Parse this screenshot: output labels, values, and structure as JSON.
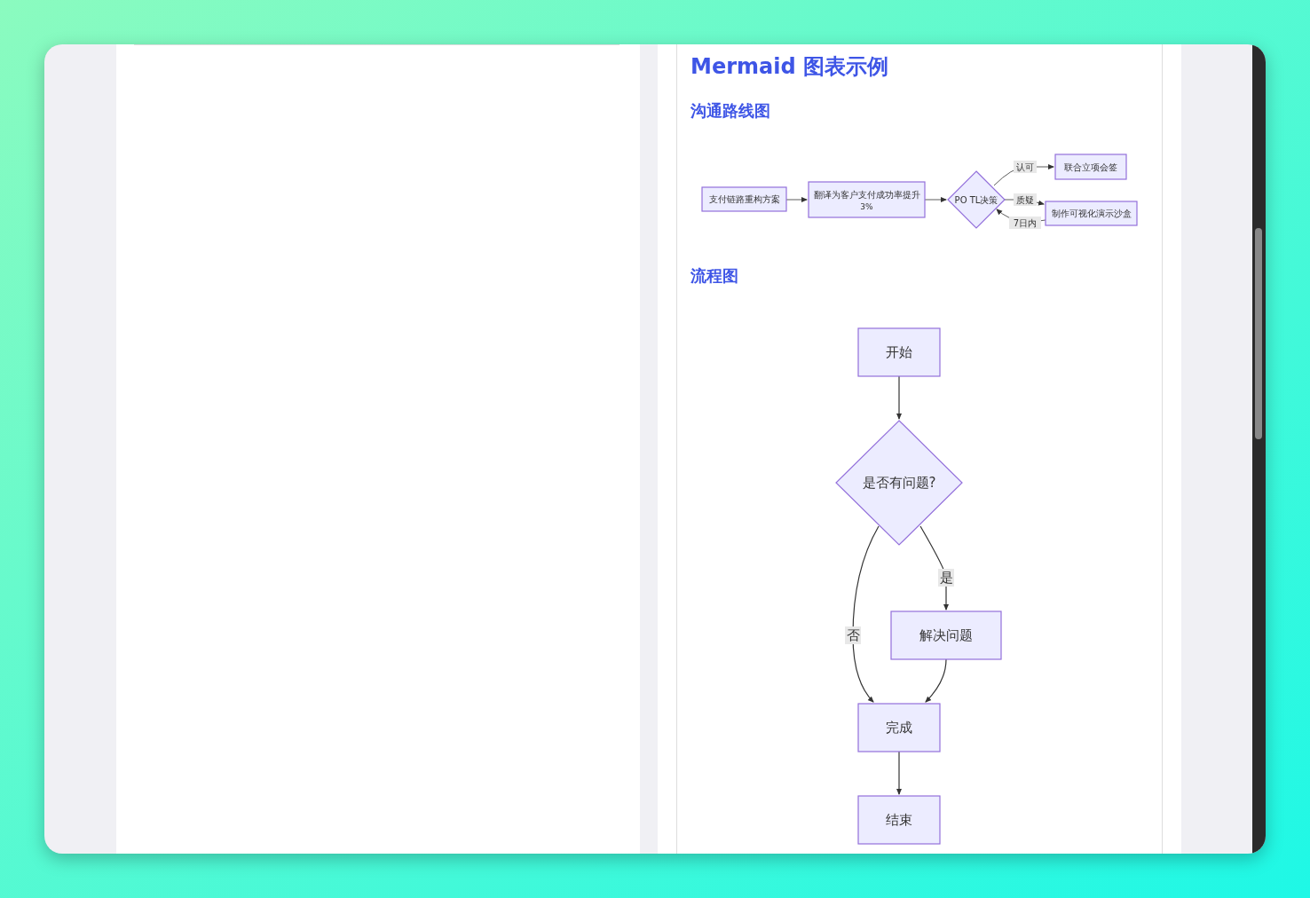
{
  "title": "Mermaid 图表示例",
  "sections": [
    {
      "heading": "沟通路线图",
      "nodes": [
        {
          "kind": "rect",
          "label": "支付链路重构方案"
        },
        {
          "kind": "rect",
          "label": "翻译为客户支付成功率提升",
          "label2": "3%"
        },
        {
          "kind": "diamond",
          "label": "PO TL决策"
        },
        {
          "kind": "rect",
          "label": "联合立项会签"
        },
        {
          "kind": "rect",
          "label": "制作可视化演示沙盒"
        }
      ],
      "edge_labels": [
        "认可",
        "质疑",
        "7日内"
      ]
    },
    {
      "heading": "流程图",
      "nodes": [
        {
          "kind": "rect",
          "label": "开始"
        },
        {
          "kind": "diamond",
          "label": "是否有问题?"
        },
        {
          "kind": "rect",
          "label": "解决问题"
        },
        {
          "kind": "rect",
          "label": "完成"
        },
        {
          "kind": "rect",
          "label": "结束"
        }
      ],
      "edge_labels": [
        "否",
        "是"
      ]
    }
  ]
}
